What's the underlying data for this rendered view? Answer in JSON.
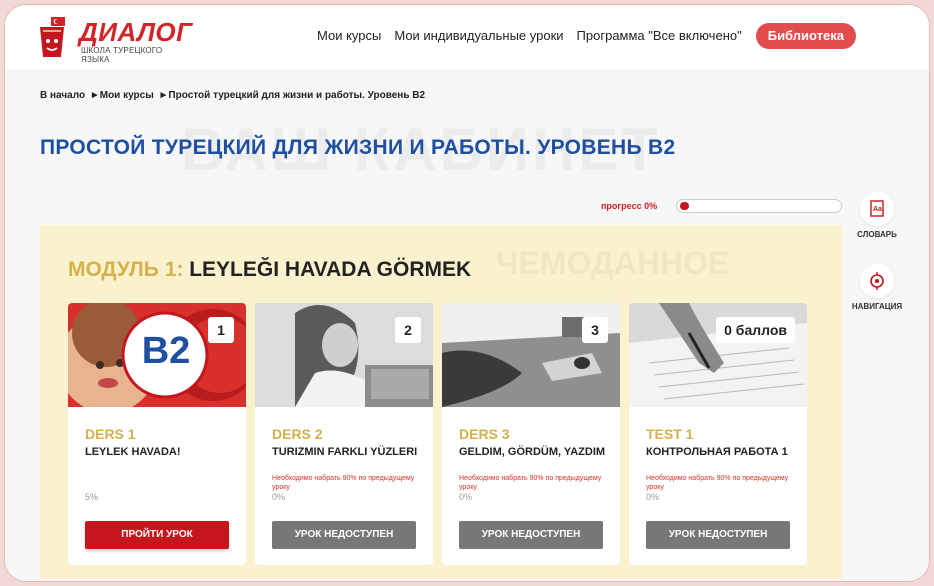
{
  "header": {
    "logo_text": "ДИАЛОГ",
    "logo_sub": "ШКОЛА ТУРЕЦКОГО ЯЗЫКА",
    "nav": [
      "Мои курсы",
      "Мои индивидуальные уроки",
      "Программа \"Все включено\""
    ],
    "library_button": "Библиотека"
  },
  "breadcrumb": [
    "В начало",
    "►Мои курсы",
    "►Простой турецкий для жизни и работы. Уровень B2"
  ],
  "watermark": "ВАШ КАБИНЕТ",
  "page_title": "ПРОСТОЙ ТУРЕЦКИЙ ДЛЯ ЖИЗНИ И РАБОТЫ. УРОВЕНЬ B2",
  "progress": {
    "label": "прогресс 0%",
    "value": 0.06
  },
  "side_tools": {
    "dictionary": "СЛОВАРЬ",
    "navigation": "НАВИГАЦИЯ"
  },
  "module": {
    "watermark": "ЧЕМОДАННОЕ",
    "title_prefix": "МОДУЛЬ 1:",
    "title_name": "LEYLEĞI HAVADA GÖRMEK",
    "cards": [
      {
        "badge": "1",
        "kind": "DERS 1",
        "name": "LEYLEK HAVADA!",
        "note": "",
        "pct": "5%",
        "button": "ПРОЙТИ УРОК",
        "image_text": "B2"
      },
      {
        "badge": "2",
        "kind": "DERS 2",
        "name": "TURIZMIN FARKLI YÜZLERI",
        "note": "Необходимо набрать 90% по предыдущему уроку",
        "pct": "0%",
        "button": "УРОК НЕДОСТУПЕН"
      },
      {
        "badge": "3",
        "kind": "DERS 3",
        "name": "GELDIM, GÖRDÜM, YAZDIM",
        "note": "Необходимо набрать 90% по предыдущему уроку",
        "pct": "0%",
        "button": "УРОК НЕДОСТУПЕН"
      },
      {
        "badge": "0 баллов",
        "kind": "TEST 1",
        "name": "КОНТРОЛЬНАЯ РАБОТА 1",
        "note": "Необходимо набрать 90% по предыдущему уроку",
        "pct": "0%",
        "button": "УРОК НЕДОСТУПЕН"
      }
    ]
  },
  "colors": {
    "brand_red": "#c4161c",
    "title_blue": "#1f4fa1",
    "module_bg": "#faf2cf",
    "gold": "#d6b048"
  }
}
